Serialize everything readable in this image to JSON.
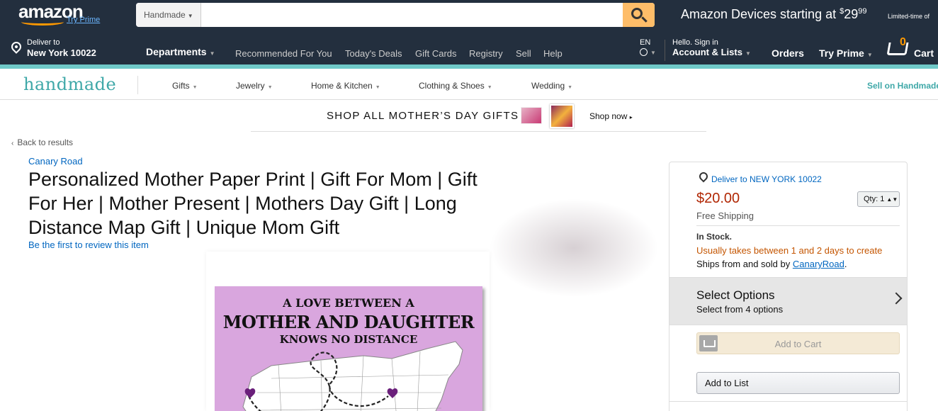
{
  "nav": {
    "logo": "amazon",
    "try_prime_small": "Try Prime",
    "search_category": "Handmade",
    "search_value": "",
    "devices_promo": {
      "text": "Amazon Devices starting at ",
      "dollar": "$",
      "whole": "29",
      "cents": "99"
    },
    "limited": "Limited-time of",
    "deliver_to_label": "Deliver to",
    "deliver_to_location": "New York 10022",
    "departments": "Departments",
    "links": [
      "Recommended For You",
      "Today's Deals",
      "Gift Cards",
      "Registry",
      "Sell",
      "Help"
    ],
    "lang": "EN",
    "account_hello": "Hello. Sign in",
    "account_lists": "Account & Lists",
    "orders": "Orders",
    "try_prime": "Try Prime",
    "cart_count": "0",
    "cart_label": "Cart",
    "accent_color": "#febd69"
  },
  "handmade": {
    "logo": "handmade",
    "links": [
      "Gifts",
      "Jewelry",
      "Home & Kitchen",
      "Clothing & Shoes",
      "Wedding"
    ],
    "sell": "Sell on Handmade",
    "accent_color": "#6fc9c8"
  },
  "promo": {
    "text": "SHOP ALL MOTHER’S DAY GIFTS",
    "shop_now": "Shop now"
  },
  "product": {
    "back": "Back to results",
    "brand": "Canary Road",
    "title": "Personalized Mother Paper Print | Gift For Mom | Gift For Her | Mother Present | Mothers Day Gift | Long Distance Map Gift | Unique Mom Gift",
    "review": "Be the first to review this item",
    "image_text": {
      "line1": "A LOVE BETWEEN A",
      "line2": "MOTHER AND DAUGHTER",
      "line3": "KNOWS NO DISTANCE"
    }
  },
  "buybox": {
    "deliver": "Deliver to NEW YORK 10022",
    "price": "$20.00",
    "qty": "Qty: 1",
    "shipping": "Free Shipping",
    "stock": "In Stock.",
    "takes": "Usually takes between 1 and 2 days to create",
    "ships_prefix": "Ships from and sold by ",
    "seller": "CanaryRoad",
    "ships_suffix": ".",
    "options_title": "Select Options",
    "options_sub": "Select from 4 options",
    "add_to_cart": "Add to Cart",
    "add_to_list": "Add to List",
    "price_color": "#b12704",
    "takes_color": "#c45500"
  }
}
